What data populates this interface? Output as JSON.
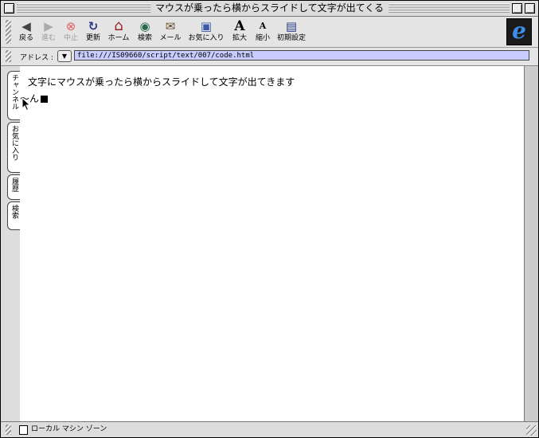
{
  "window": {
    "title": "マウスが乗ったら横からスライドして文字が出てくる"
  },
  "toolbar": {
    "buttons": [
      {
        "label": "戻る",
        "icon": "back-arrow-icon",
        "glyph": "◀"
      },
      {
        "label": "進む",
        "icon": "forward-arrow-icon",
        "glyph": "▶"
      },
      {
        "label": "中止",
        "icon": "stop-icon",
        "glyph": "⊗"
      },
      {
        "label": "更新",
        "icon": "refresh-icon",
        "glyph": "↻"
      },
      {
        "label": "ホーム",
        "icon": "home-icon",
        "glyph": "⌂"
      },
      {
        "label": "検索",
        "icon": "search-icon",
        "glyph": "◉"
      },
      {
        "label": "メール",
        "icon": "mail-icon",
        "glyph": "✉"
      },
      {
        "label": "お気に入り",
        "icon": "favorites-icon",
        "glyph": "▣"
      },
      {
        "label": "拡大",
        "icon": "text-larger-icon",
        "glyph": "A"
      },
      {
        "label": "縮小",
        "icon": "text-smaller-icon",
        "glyph": "A"
      },
      {
        "label": "初期設定",
        "icon": "preferences-icon",
        "glyph": "▤"
      }
    ],
    "logo_letter": "e"
  },
  "address": {
    "label": "アドレス :",
    "value": "file:///IS09660/script/text/007/code.html"
  },
  "sidebar": {
    "tabs": [
      "チャンネル",
      "お気に入り",
      "履歴",
      "検索"
    ]
  },
  "content": {
    "line1": "文字にマウスが乗ったら横からスライドして文字が出てきます",
    "line2": "～ん"
  },
  "status": {
    "text": "ローカル マシン ゾーン"
  },
  "colors": {
    "address_field_bg": "#c8ccff",
    "ie_logo_blue": "#3a8fe8",
    "content_bg": "#ffffff"
  }
}
